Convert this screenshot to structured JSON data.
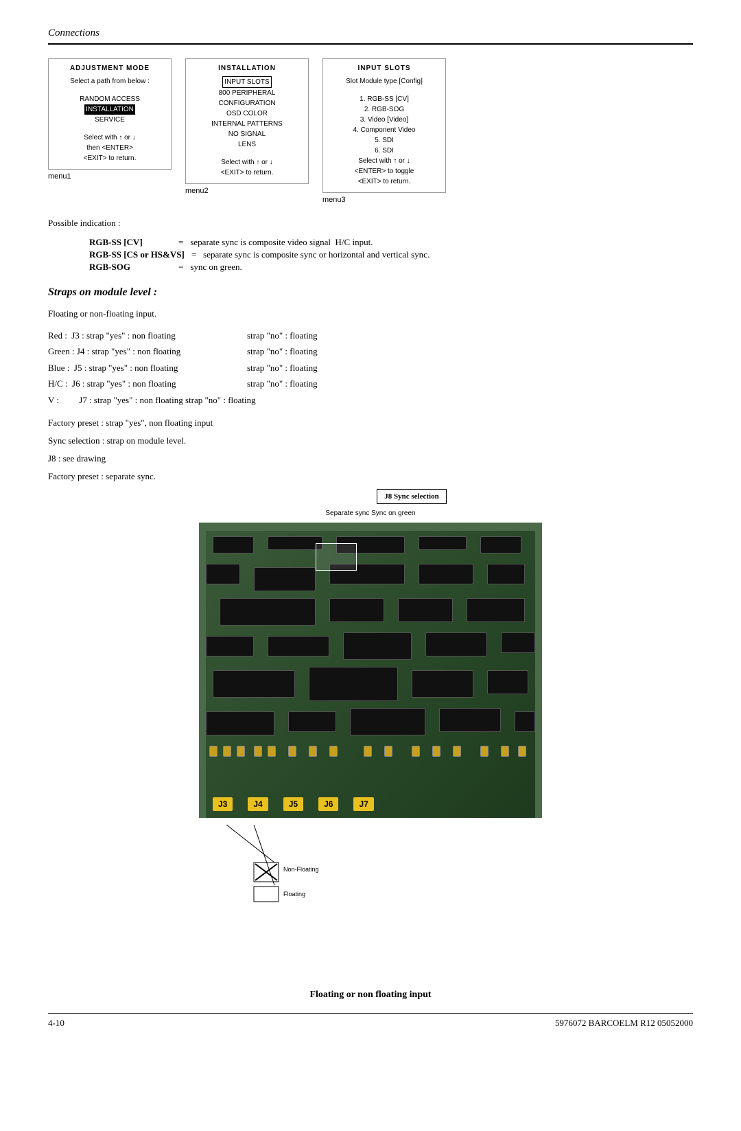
{
  "header": {
    "title": "Connections"
  },
  "menus": [
    {
      "id": "menu1",
      "title": "ADJUSTMENT MODE",
      "label": "menu1",
      "content": [
        "Select a path from below :",
        "",
        "RANDOM ACCESS",
        "INSTALLATION",
        "SERVICE",
        "",
        "Select with ↑ or ↓",
        "then <ENTER>",
        "<EXIT> to return."
      ],
      "highlighted": [
        "INSTALLATION"
      ]
    },
    {
      "id": "menu2",
      "title": "INSTALLATION",
      "label": "menu2",
      "content": [
        "INPUT SLOTS",
        "800 PERIPHERAL",
        "CONFIGURATION",
        "OSD COLOR",
        "INTERNAL PATTERNS",
        "NO SIGNAL",
        "LENS",
        "",
        "Select with ↑ or ↓",
        "<EXIT> to return."
      ],
      "highlighted": [
        "INPUT SLOTS"
      ]
    },
    {
      "id": "menu3",
      "title": "INPUT SLOTS",
      "label": "menu3",
      "content": [
        "Slot Module type [Config]",
        "",
        "1. RGB-SS [CV]",
        "2. RGB-SOG",
        "3. Video [Video]",
        "4. Component Video",
        "5. SDI",
        "6. SDI",
        "Select with ↑ or ↓",
        "<ENTER> to toggle",
        "<EXIT> to return."
      ]
    }
  ],
  "possible_indication": {
    "label": "Possible indication :",
    "rows": [
      {
        "key": "RGB-SS [CV]",
        "eq": "=",
        "val": "separate sync is composite video signal  H/C input."
      },
      {
        "key": "RGB-SS [CS or HS&VS]",
        "eq": "=",
        "val": "separate sync is composite sync or horizontal and vertical sync."
      },
      {
        "key": "RGB-SOG",
        "eq": "=",
        "val": "sync on green."
      }
    ]
  },
  "straps_section": {
    "title": "Straps on module level :",
    "intro": "Floating or non-floating input.",
    "strap_rows": [
      {
        "label": "Red :   J3 : strap \"yes\" : non floating",
        "right": "strap \"no\" : floating"
      },
      {
        "label": "Green : J4 : strap \"yes\" : non floating",
        "right": "strap \"no\" : floating"
      },
      {
        "label": "Blue :  J5 : strap \"yes\" : non floating",
        "right": "strap \"no\" : floating"
      },
      {
        "label": "H/C :  J6 : strap \"yes\" : non floating",
        "right": "strap \"no\" : floating"
      },
      {
        "label": "V :          J7 : strap \"yes\" : non floating strap \"no\" : floating",
        "right": ""
      }
    ],
    "factory_preset": "Factory preset : strap \"yes\", non floating input",
    "sync_selection": "Sync selection : strap on module level.",
    "j8_note": "J8 : see drawing",
    "factory_preset2": "Factory preset : separate sync."
  },
  "diagram": {
    "j8_title": "J8 Sync selection",
    "j8_sub": "Separate sync    Sync on green",
    "connectors": [
      "J3",
      "J4",
      "J5",
      "J6",
      "J7"
    ],
    "non_floating_label": "Non-Floating",
    "floating_label": "Floating",
    "bottom_label": "Floating or non floating input"
  },
  "footer": {
    "left": "4-10",
    "right": "5976072 BARCOELM R12 05052000"
  }
}
